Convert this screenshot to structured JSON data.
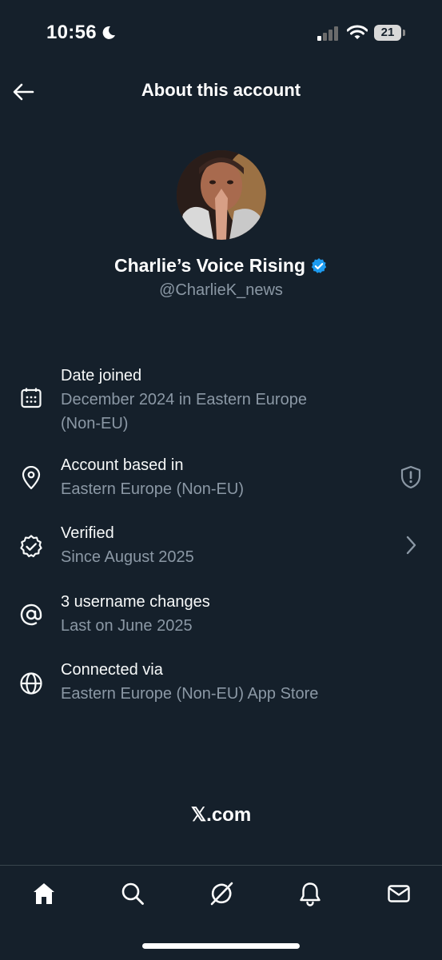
{
  "status_bar": {
    "time": "10:56",
    "battery": "21"
  },
  "header": {
    "title": "About this account"
  },
  "profile": {
    "name": "Charlie’s Voice Rising",
    "handle": "@CharlieK_news"
  },
  "rows": [
    {
      "icon": "calendar-icon",
      "title": "Date joined",
      "sub1": "December 2024 in Eastern Europe",
      "sub2": "(Non-EU)"
    },
    {
      "icon": "location-pin-icon",
      "title": "Account based in",
      "sub1": "Eastern Europe (Non-EU)",
      "trail": "shield-alert-icon"
    },
    {
      "icon": "verified-badge-icon",
      "title": "Verified",
      "sub1": "Since August 2025",
      "trail": "chevron-right-icon"
    },
    {
      "icon": "at-icon",
      "title": "3 username changes",
      "sub1": "Last on June 2025"
    },
    {
      "icon": "globe-icon",
      "title": "Connected via",
      "sub1": "Eastern Europe (Non-EU) App Store"
    }
  ],
  "footer": {
    "brand": "𝕏.com"
  },
  "tabs": [
    "home-icon",
    "search-icon",
    "grok-icon",
    "notifications-icon",
    "messages-icon"
  ],
  "colors": {
    "background": "#15202b",
    "secondary_text": "#8b98a5",
    "verified_blue": "#1d9bf0"
  }
}
